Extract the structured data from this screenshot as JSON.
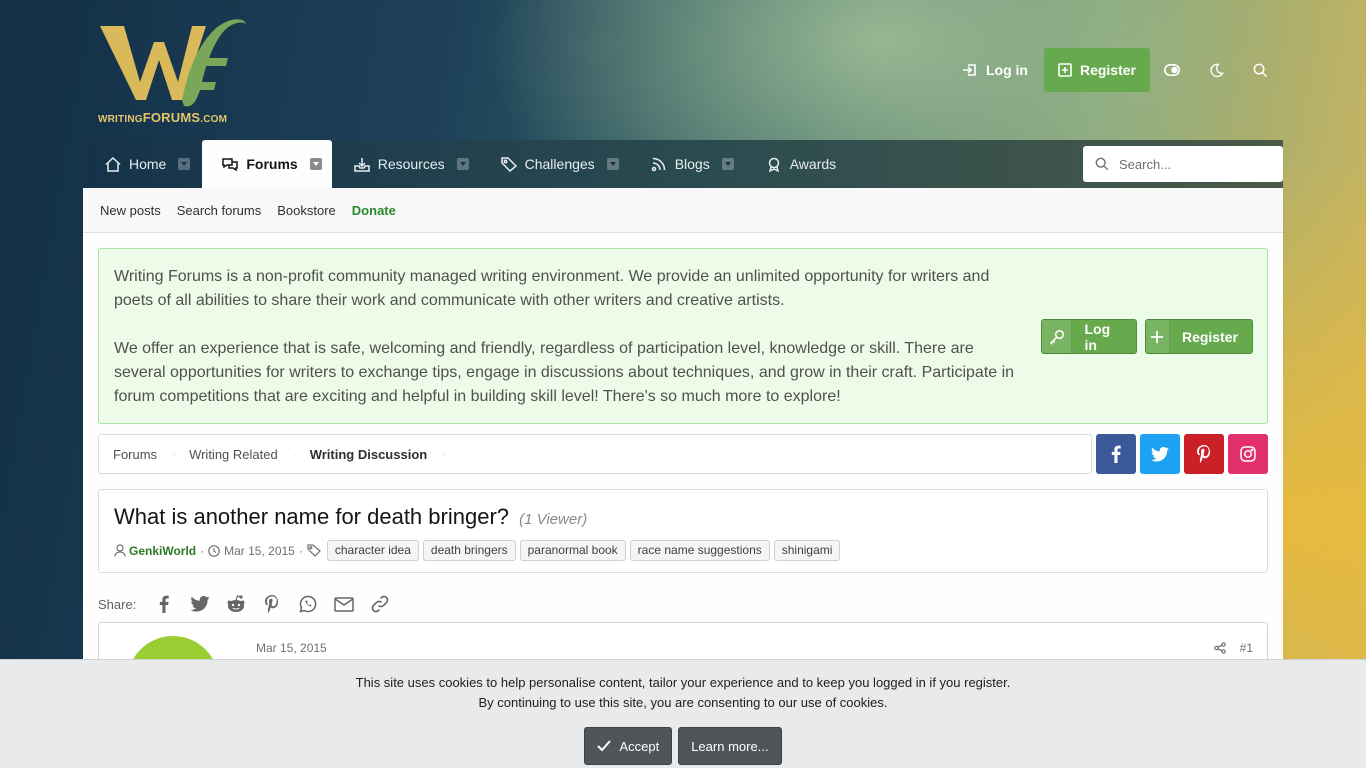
{
  "header": {
    "logo_text_main": "WRITING",
    "logo_text_mid": "FORUMS",
    "logo_text_end": ".COM",
    "login_label": "Log in",
    "register_label": "Register"
  },
  "nav": {
    "tabs": [
      {
        "label": "Home",
        "icon": "home-icon"
      },
      {
        "label": "Forums",
        "icon": "forums-icon",
        "active": true
      },
      {
        "label": "Resources",
        "icon": "resources-icon"
      },
      {
        "label": "Challenges",
        "icon": "tag-icon"
      },
      {
        "label": "Blogs",
        "icon": "rss-icon"
      },
      {
        "label": "Awards",
        "icon": "award-icon"
      }
    ],
    "search_placeholder": "Search..."
  },
  "subnav": {
    "items": [
      "New posts",
      "Search forums",
      "Bookstore",
      "Donate"
    ]
  },
  "notice": {
    "paragraph1": "Writing Forums is a non-profit community managed writing environment. We provide an unlimited opportunity for writers and poets of all abilities to share their work and communicate with other writers and creative artists.",
    "paragraph2": "We offer an experience that is safe, welcoming and friendly, regardless of participation level, knowledge or skill. There are several opportunities for writers to exchange tips, engage in discussions about techniques, and grow in their craft. Participate in forum competitions that are exciting and helpful in building skill level! There's so much more to explore!",
    "login_label": "Log in",
    "register_label": "Register"
  },
  "breadcrumb": [
    "Forums",
    "Writing Related",
    "Writing Discussion"
  ],
  "thread": {
    "title": "What is another name for death bringer?",
    "viewers": "(1 Viewer)",
    "author": "GenkiWorld",
    "date": "Mar 15, 2015",
    "tags": [
      "character idea",
      "death bringers",
      "paranormal book",
      "race name suggestions",
      "shinigami"
    ]
  },
  "share": {
    "label": "Share:"
  },
  "post": {
    "date": "Mar 15, 2015",
    "number": "#1"
  },
  "cookie": {
    "line1": "This site uses cookies to help personalise content, tailor your experience and to keep you logged in if you register.",
    "line2": "By continuing to use this site, you are consenting to our use of cookies.",
    "accept_label": "Accept",
    "learn_label": "Learn more..."
  },
  "colors": {
    "accent_green": "#66aa4d",
    "facebook": "#3b5998",
    "twitter": "#1da1f2",
    "pinterest": "#cb2027",
    "instagram": "#e1306c"
  }
}
